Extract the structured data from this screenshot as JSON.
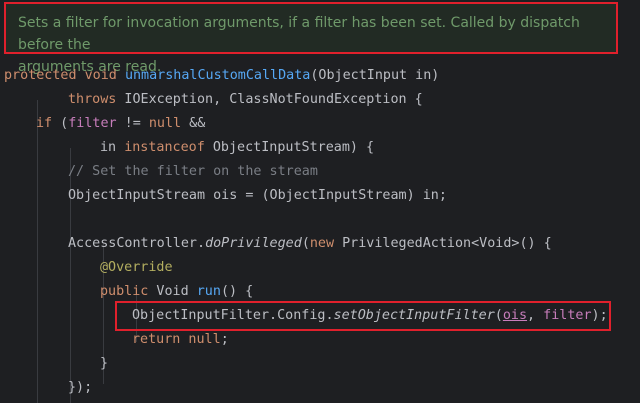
{
  "doc_comment": {
    "line1": "Sets a filter for invocation arguments, if a filter has been set. Called by dispatch before the",
    "line2": "arguments are read."
  },
  "code": {
    "l1_kw1": "protected",
    "l1_kw2": "void",
    "l1_fn": "unmarshalCustomCallData",
    "l1_rest": "(ObjectInput in)",
    "l2_kw": "throws",
    "l2_rest": " IOException, ClassNotFoundException {",
    "l3_kw": "if",
    "l3_p1": " (",
    "l3_field": "filter",
    "l3_p2": " != ",
    "l3_null": "null",
    "l3_p3": " &&",
    "l4_in": "in ",
    "l4_kw": "instanceof",
    "l4_rest": " ObjectInputStream) {",
    "l5_comment": "// Set the filter on the stream",
    "l6_text": "ObjectInputStream ois = (ObjectInputStream) in;",
    "l7_p1": "AccessController.",
    "l7_method": "doPrivileged",
    "l7_p2": "(",
    "l7_kw": "new",
    "l7_p3": " PrivilegedAction<Void>() {",
    "l8_ann": "@Override",
    "l9_kw": "public",
    "l9_p1": " Void ",
    "l9_fn": "run",
    "l9_p2": "() {",
    "l10_p1": "ObjectInputFilter.Config.",
    "l10_method": "setObjectInputFilter",
    "l10_p2": "(",
    "l10_ois": "ois",
    "l10_p3": ", ",
    "l10_field": "filter",
    "l10_p4": ");",
    "l11_kw": "return",
    "l11_null": " null",
    "l11_p": ";",
    "l12_text": "}",
    "l13_text": "});"
  },
  "colors": {
    "highlight_border": "#e0202c",
    "background": "#1e1f22",
    "keyword": "#cf8e6d",
    "function": "#56a8f5",
    "field": "#c77dbb",
    "comment": "#7a7e85",
    "annotation": "#b3ae60",
    "doc_comment": "#6f9a6a"
  }
}
